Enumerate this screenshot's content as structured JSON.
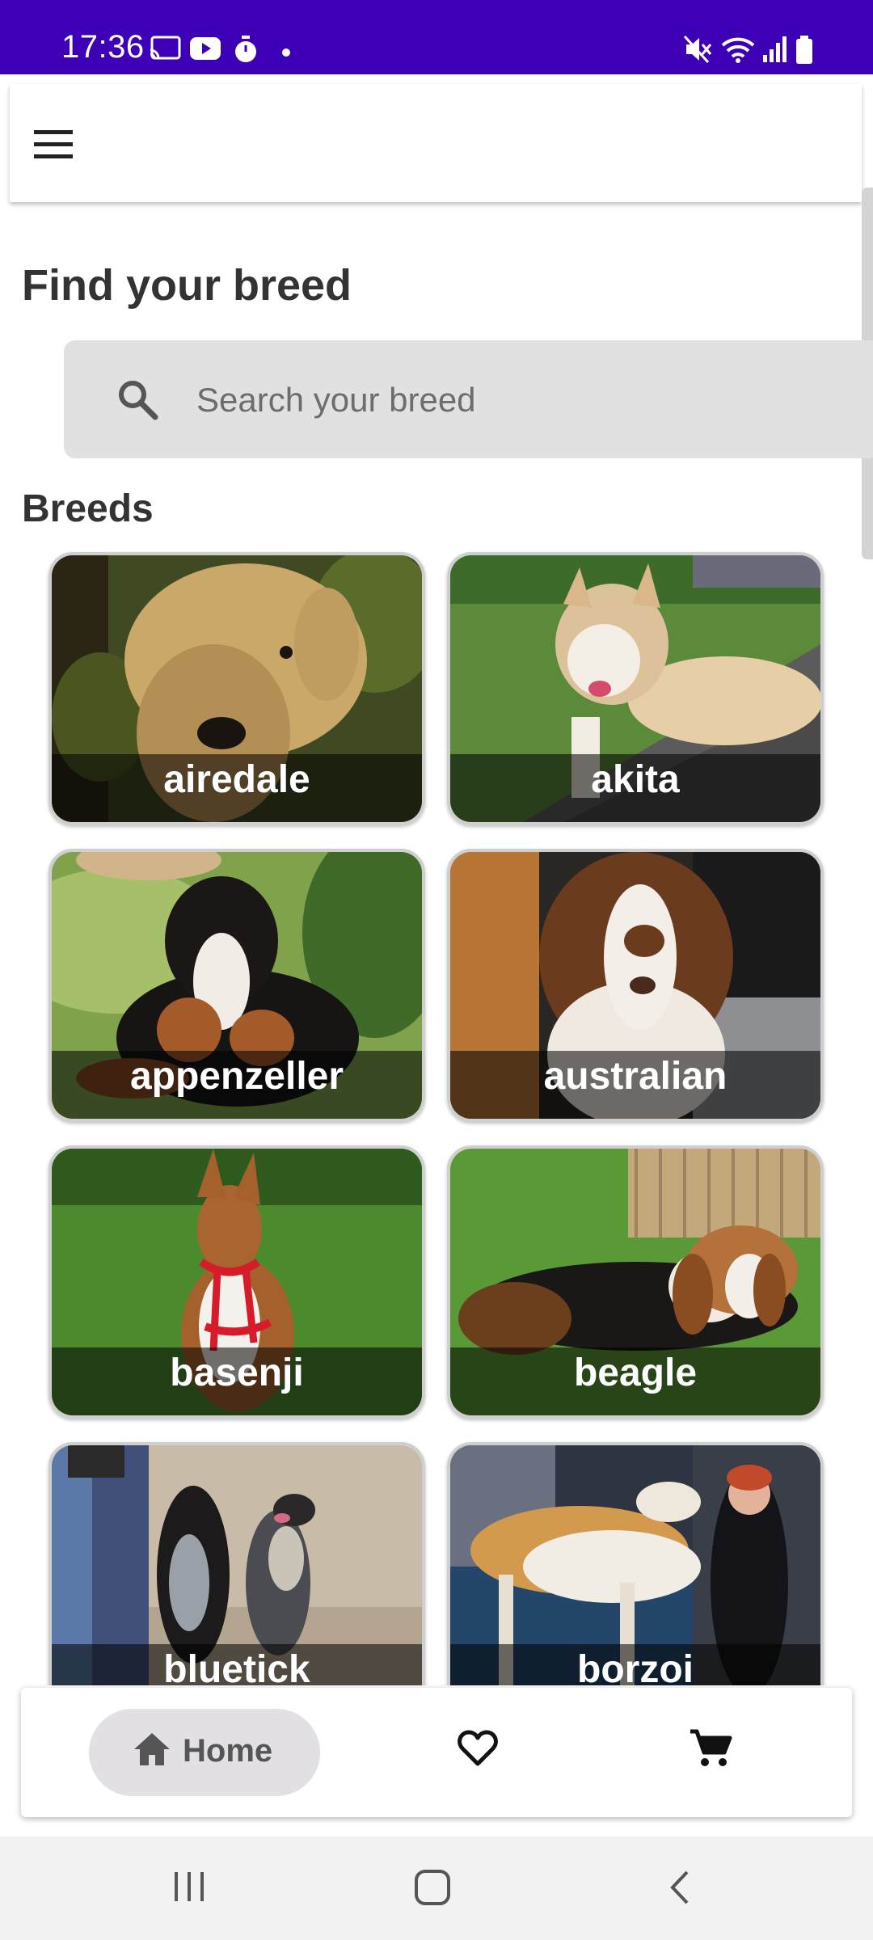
{
  "status_bar": {
    "time": "17:36",
    "left_icons": [
      "cast-icon",
      "youtube-icon",
      "stopwatch-icon",
      "dot-icon"
    ],
    "right_icons": [
      "mute-icon",
      "wifi-icon",
      "signal-icon",
      "battery-icon"
    ],
    "color": "#3d00b6"
  },
  "app_bar": {
    "menu_icon": "hamburger-menu-icon"
  },
  "page": {
    "heading": "Find your breed",
    "section_title": "Breeds"
  },
  "search": {
    "placeholder": "Search your breed",
    "value": "",
    "icon": "search-icon"
  },
  "breeds": [
    {
      "name": "airedale"
    },
    {
      "name": "akita"
    },
    {
      "name": "appenzeller"
    },
    {
      "name": "australian"
    },
    {
      "name": "basenji"
    },
    {
      "name": "beagle"
    },
    {
      "name": "bluetick"
    },
    {
      "name": "borzoi"
    }
  ],
  "bottom_nav": {
    "items": [
      {
        "label": "Home",
        "icon": "home-icon",
        "selected": true
      },
      {
        "label": "",
        "icon": "heart-outline-icon",
        "selected": false
      },
      {
        "label": "",
        "icon": "cart-icon",
        "selected": false
      }
    ]
  },
  "system_nav": {
    "buttons": [
      "recents-icon",
      "home-button-icon",
      "back-icon"
    ]
  }
}
